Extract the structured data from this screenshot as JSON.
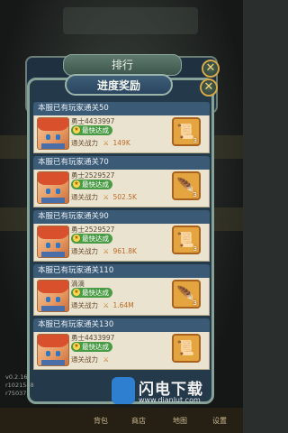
{
  "ranking_panel": {
    "title": "排行"
  },
  "reward_panel": {
    "title": "进度奖励"
  },
  "entries": [
    {
      "header": "本服已有玩家通关50",
      "player": "勇士4433997",
      "badge": "最快达成",
      "power_label": "通关战力",
      "power": "149K",
      "reward_count": "3",
      "reward_icon": "treasure-scroll-icon"
    },
    {
      "header": "本服已有玩家通关70",
      "player": "勇士2529527",
      "badge": "最快达成",
      "power_label": "通关战力",
      "power": "502.5K",
      "reward_count": "3",
      "reward_icon": "feather-quill-icon"
    },
    {
      "header": "本服已有玩家通关90",
      "player": "勇士2529527",
      "badge": "最快达成",
      "power_label": "通关战力",
      "power": "961.8K",
      "reward_count": "3",
      "reward_icon": "treasure-scroll-icon"
    },
    {
      "header": "本服已有玩家通关110",
      "player": "滴滴",
      "badge": "最快达成",
      "power_label": "通关战力",
      "power": "1.64M",
      "reward_count": "3",
      "reward_icon": "feather-quill-icon"
    },
    {
      "header": "本服已有玩家通关130",
      "player": "勇士4433997",
      "badge": "最快达成",
      "power_label": "通关战力",
      "power": "",
      "reward_count": "",
      "reward_icon": "treasure-scroll-icon"
    }
  ],
  "version_info": "v0.2.16",
  "version_line2": "r1021548",
  "version_line3": "r75037",
  "bottom_nav": [
    "背包",
    "商店",
    "地图",
    "设置"
  ],
  "watermark": {
    "name": "闪电下载",
    "url": "www.dianlut.com"
  },
  "colors": {
    "panel": "#24394a",
    "entry_header": "#3b5a75",
    "card": "#e9e3cf",
    "badge": "#4a9b45",
    "power_value": "#c06a25"
  }
}
